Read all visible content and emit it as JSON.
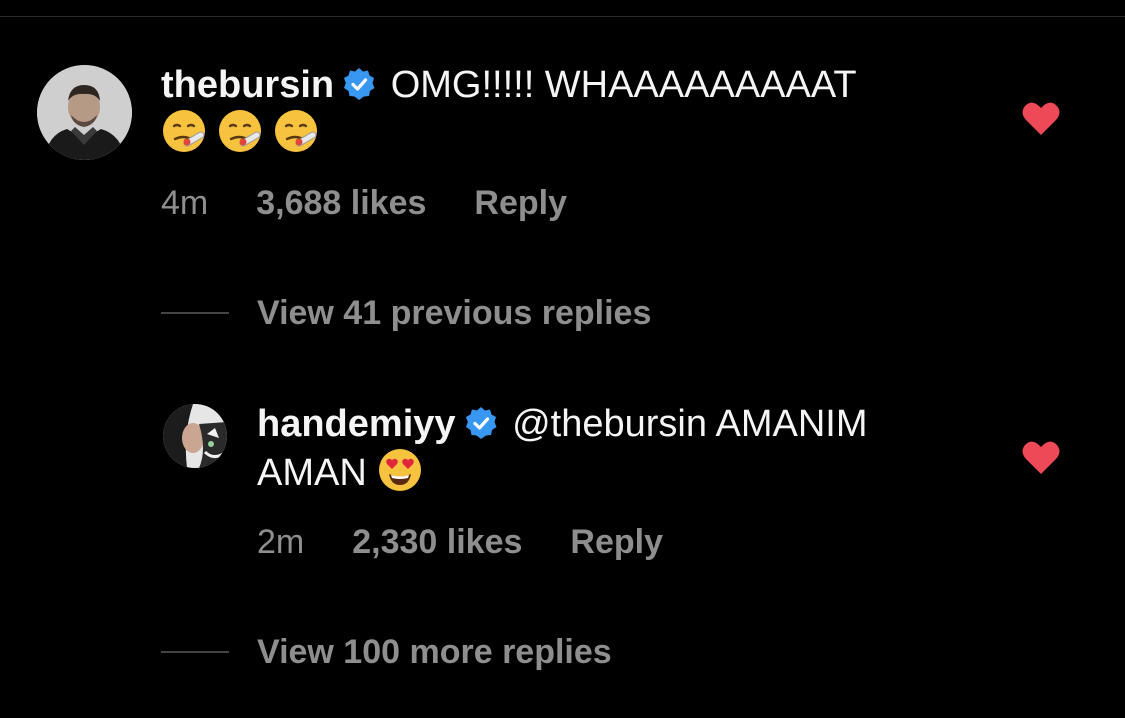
{
  "comments": [
    {
      "username": "thebursin",
      "text": "OMG!!!!! WHAAAAAAAAAT",
      "emojis": [
        "face-with-thermometer",
        "face-with-thermometer",
        "face-with-thermometer"
      ],
      "time": "4m",
      "likes": "3,688 likes",
      "reply": "Reply",
      "view_replies": "View 41 previous replies"
    },
    {
      "username": "handemiyy",
      "mention": "@thebursin",
      "text_line1": "AMANIM",
      "text_line2": "AMAN",
      "emojis": [
        "heart-eyes-face"
      ],
      "time": "2m",
      "likes": "2,330 likes",
      "reply": "Reply",
      "view_replies": "View 100 more replies"
    }
  ],
  "colors": {
    "background": "#000000",
    "text": "#f5f5f5",
    "muted": "#8e8e8e",
    "verified": "#3897f0",
    "heart": "#ed4956"
  }
}
